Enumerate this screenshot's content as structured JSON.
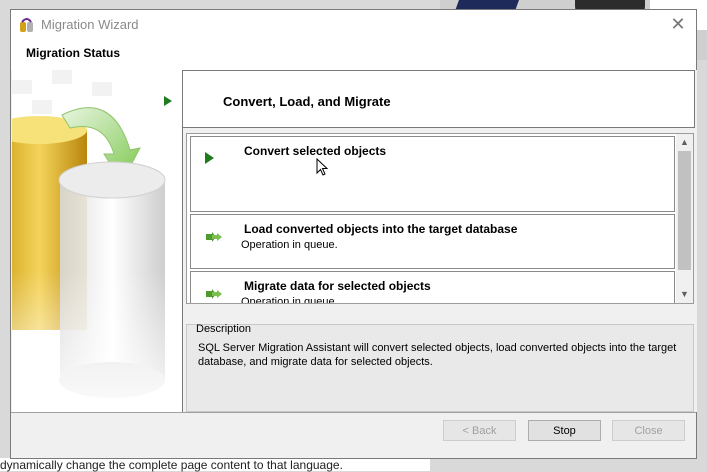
{
  "window": {
    "title": "Migration Wizard",
    "header_title": "Migration Status"
  },
  "step": {
    "title": "Convert, Load, and Migrate"
  },
  "operations": [
    {
      "title": "Convert selected objects",
      "status": "",
      "icon": "play-arrow-icon"
    },
    {
      "title": "Load converted objects into the target database",
      "status": "Operation in queue.",
      "icon": "double-arrow-icon"
    },
    {
      "title": "Migrate data for selected objects",
      "status": "Operation in queue.",
      "icon": "double-arrow-icon"
    }
  ],
  "description": {
    "label": "Description",
    "text": "SQL Server Migration Assistant will convert selected objects, load converted objects into the target database, and migrate data for selected objects."
  },
  "buttons": {
    "back": "< Back",
    "stop": "Stop",
    "close": "Close"
  },
  "background": {
    "page_text": "dynamically change the complete page content to that language."
  },
  "colors": {
    "accent_green": "#1e7b1e",
    "window_bg": "#f0f0f0"
  }
}
